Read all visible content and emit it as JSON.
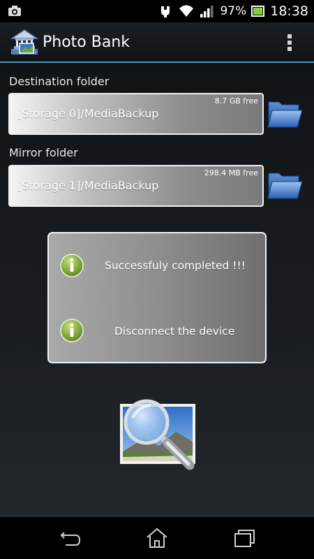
{
  "status_bar": {
    "left_icon": "screenshot-camera-icon",
    "icons": [
      "usb-debug-icon",
      "wifi-icon",
      "signal-icon",
      "battery-icon"
    ],
    "battery": "97%",
    "time": "18:38"
  },
  "action_bar": {
    "title": "Photo Bank",
    "app_icon": "bank-building-icon",
    "menu_icon": "overflow-menu-icon",
    "accent_color": "#4b94b8"
  },
  "destination": {
    "label": "Destination folder",
    "path": "[Storage 0]/MediaBackup",
    "free": "8.7 GB free"
  },
  "mirror": {
    "label": "Mirror folder",
    "path": "[Storage 1]/MediaBackup",
    "free": "298.4 MB free"
  },
  "status_panel": {
    "messages": [
      "Successfuly completed !!!",
      "Disconnect the device"
    ],
    "icon": "info-green-icon",
    "icon_color": "#7aa62a"
  },
  "search_button": {
    "icon": "magnifier-photo-icon"
  },
  "nav_bar": {
    "icons": [
      "back-icon",
      "home-icon",
      "recent-apps-icon"
    ]
  }
}
